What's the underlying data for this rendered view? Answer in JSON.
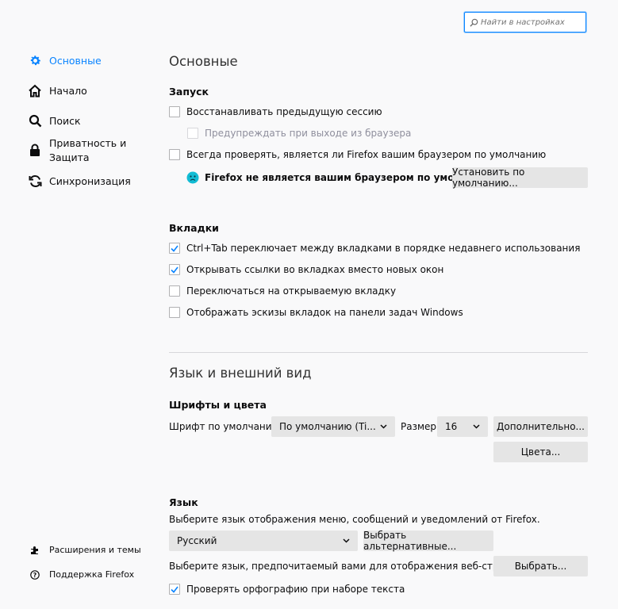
{
  "search": {
    "placeholder": "Найти в настройках"
  },
  "sidebar": {
    "items": [
      {
        "label": "Основные",
        "active": true
      },
      {
        "label": "Начало"
      },
      {
        "label": "Поиск"
      },
      {
        "label_line1": "Приватность и",
        "label_line2": "Защита"
      },
      {
        "label": "Синхронизация"
      }
    ],
    "footer": [
      {
        "label": "Расширения и темы"
      },
      {
        "label": "Поддержка Firefox"
      }
    ]
  },
  "general": {
    "title": "Основные",
    "startup": {
      "heading": "Запуск",
      "restore_session": "Восстанавливать предыдущую сессию",
      "warn_on_quit": "Предупреждать при выходе из браузера",
      "check_default": "Всегда проверять, является ли Firefox вашим браузером по умолчанию",
      "not_default_text": "Firefox не является вашим браузером по умолчанию",
      "set_default_button": "Установить по умолчанию..."
    },
    "tabs": {
      "heading": "Вкладки",
      "items": [
        {
          "label": "Ctrl+Tab переключает между вкладками в порядке недавнего использования",
          "checked": true
        },
        {
          "label": "Открывать ссылки во вкладках вместо новых окон",
          "checked": true
        },
        {
          "label": "Переключаться на открываемую вкладку",
          "checked": false
        },
        {
          "label": "Отображать эскизы вкладок на панели задач Windows",
          "checked": false
        }
      ]
    }
  },
  "appearance": {
    "title": "Язык и внешний вид",
    "fonts": {
      "heading": "Шрифты и цвета",
      "default_font_label": "Шрифт по умолчанию",
      "default_font_value": "По умолчанию (Ti...",
      "size_label": "Размер",
      "size_value": "16",
      "advanced_button": "Дополнительно...",
      "colors_button": "Цвета..."
    },
    "language": {
      "heading": "Язык",
      "ui_desc": "Выберите язык отображения меню, сообщений и уведомлений от Firefox.",
      "ui_language_value": "Русский",
      "alternatives_button": "Выбрать альтернативные...",
      "web_desc": "Выберите язык, предпочитаемый вами для отображения веб-страниц",
      "choose_button": "Выбрать...",
      "spellcheck": "Проверять орфографию при наборе текста",
      "spellcheck_checked": true
    }
  },
  "colors": {
    "accent": "#0a84ff",
    "button": "#e5e5e5",
    "divider": "#d7d7db"
  }
}
